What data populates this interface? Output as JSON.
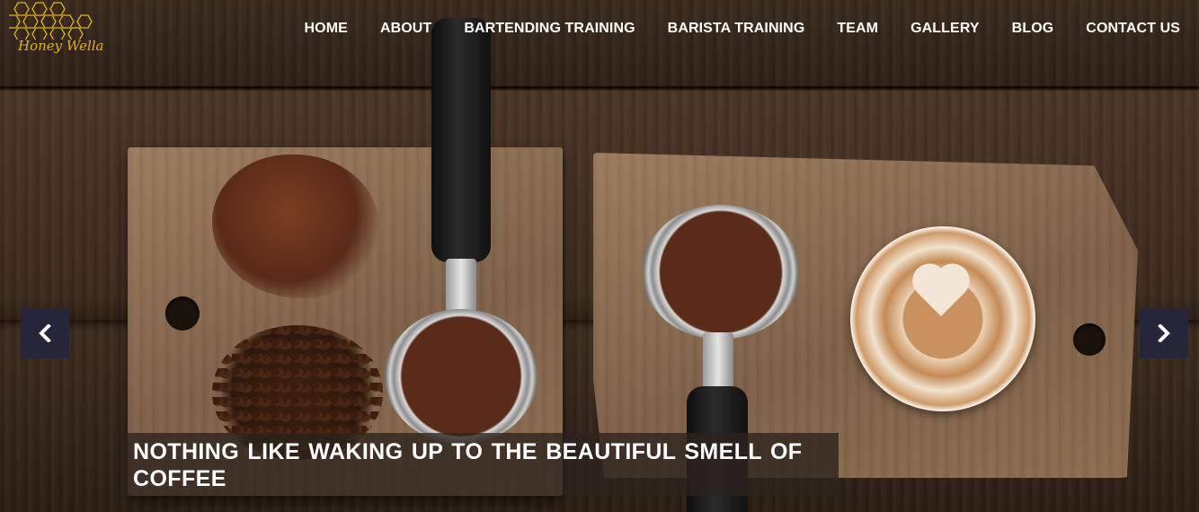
{
  "brand": {
    "name": "Honey Wella",
    "accent_color": "#e0b21e"
  },
  "nav": {
    "items": [
      {
        "label": "HOME"
      },
      {
        "label": "ABOUT"
      },
      {
        "label": "BARTENDING TRAINING"
      },
      {
        "label": "BARISTA TRAINING"
      },
      {
        "label": "TEAM"
      },
      {
        "label": "GALLERY"
      },
      {
        "label": "BLOG"
      },
      {
        "label": "CONTACT US"
      }
    ]
  },
  "slider": {
    "caption": "NOTHING LIKE WAKING UP TO THE BEAUTIFUL SMELL OF COFFEE",
    "prev_icon": "chevron-left-icon",
    "next_icon": "chevron-right-icon",
    "arrow_bg": "#25263a"
  }
}
